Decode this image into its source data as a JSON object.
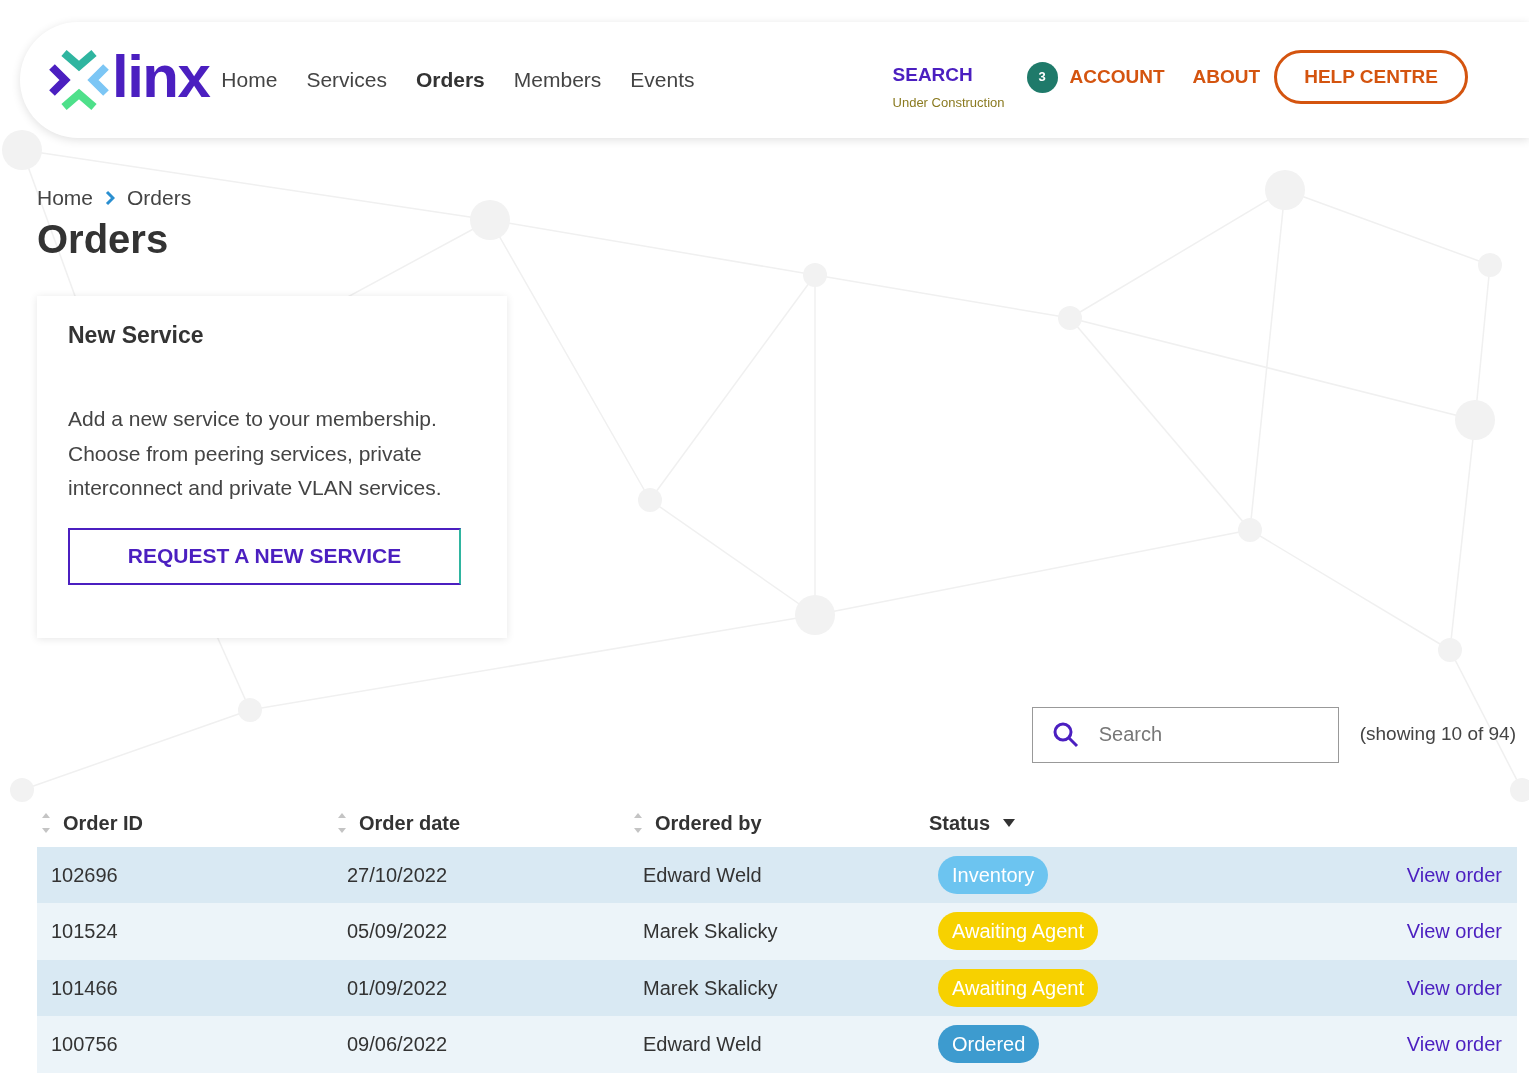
{
  "header": {
    "logo_text": "linx",
    "nav": [
      {
        "label": "Home",
        "selected": false
      },
      {
        "label": "Services",
        "selected": false
      },
      {
        "label": "Orders",
        "selected": true
      },
      {
        "label": "Members",
        "selected": false
      },
      {
        "label": "Events",
        "selected": false
      }
    ],
    "search_link": {
      "label": "SEARCH",
      "note": "Under Construction"
    },
    "account": {
      "badge": "3",
      "label": "ACCOUNT"
    },
    "about": "ABOUT",
    "help_button": "HELP CENTRE"
  },
  "breadcrumb": [
    "Home",
    "Orders"
  ],
  "page_title": "Orders",
  "new_service_card": {
    "title": "New Service",
    "text": "Add a new service to your membership. Choose from peering services, private interconnect and private VLAN services.",
    "button": "REQUEST A NEW SERVICE"
  },
  "table_search": {
    "placeholder": "Search",
    "count": "(showing 10 of 94)"
  },
  "table": {
    "columns": [
      {
        "label": "Order ID",
        "kind": "sort"
      },
      {
        "label": "Order date",
        "kind": "sort"
      },
      {
        "label": "Ordered by",
        "kind": "sort"
      },
      {
        "label": "Status",
        "kind": "filter"
      }
    ],
    "rows": [
      {
        "id": "102696",
        "date": "27/10/2022",
        "by": "Edward Weld",
        "status": "Inventory",
        "color": "#6cc4f0",
        "link": "View order"
      },
      {
        "id": "101524",
        "date": "05/09/2022",
        "by": "Marek Skalicky",
        "status": "Awaiting Agent",
        "color": "#f7d100",
        "link": "View order"
      },
      {
        "id": "101466",
        "date": "01/09/2022",
        "by": "Marek Skalicky",
        "status": "Awaiting Agent",
        "color": "#f7d100",
        "link": "View order"
      },
      {
        "id": "100756",
        "date": "09/06/2022",
        "by": "Edward Weld",
        "status": "Ordered",
        "color": "#3d9bcf",
        "link": "View order"
      }
    ]
  }
}
